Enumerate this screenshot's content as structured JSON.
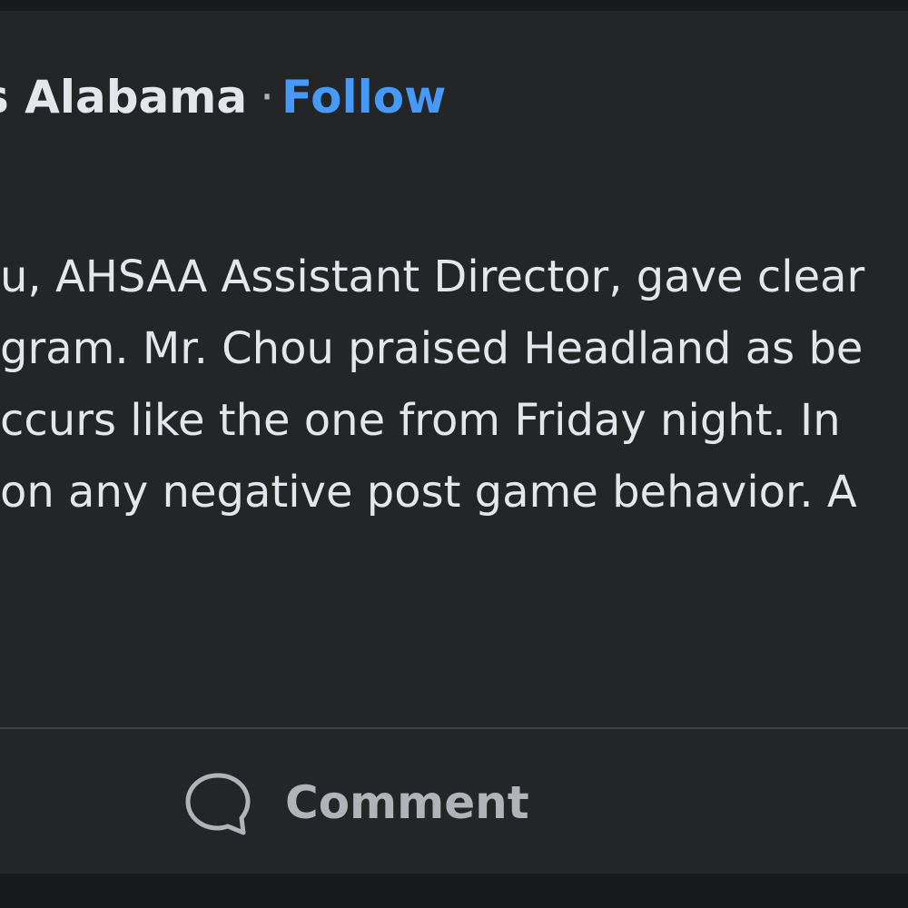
{
  "post": {
    "header": {
      "page_name_fragment": "s Alabama",
      "separator": "·",
      "follow_label": "Follow"
    },
    "body_lines": [
      "u, AHSAA Assistant Director, gave clear",
      "gram. Mr. Chou praised Headland as be",
      "ccurs like the one from Friday night. In",
      "on any negative post game behavior. A"
    ],
    "actions": {
      "comment_label": "Comment"
    }
  },
  "colors": {
    "background": "#18191a",
    "card": "#242526",
    "text_primary": "#e4e6eb",
    "text_secondary": "#b0b3b8",
    "link": "#4599ff",
    "divider": "#3e4042"
  },
  "icons": {
    "comment": "speech-bubble-icon"
  }
}
